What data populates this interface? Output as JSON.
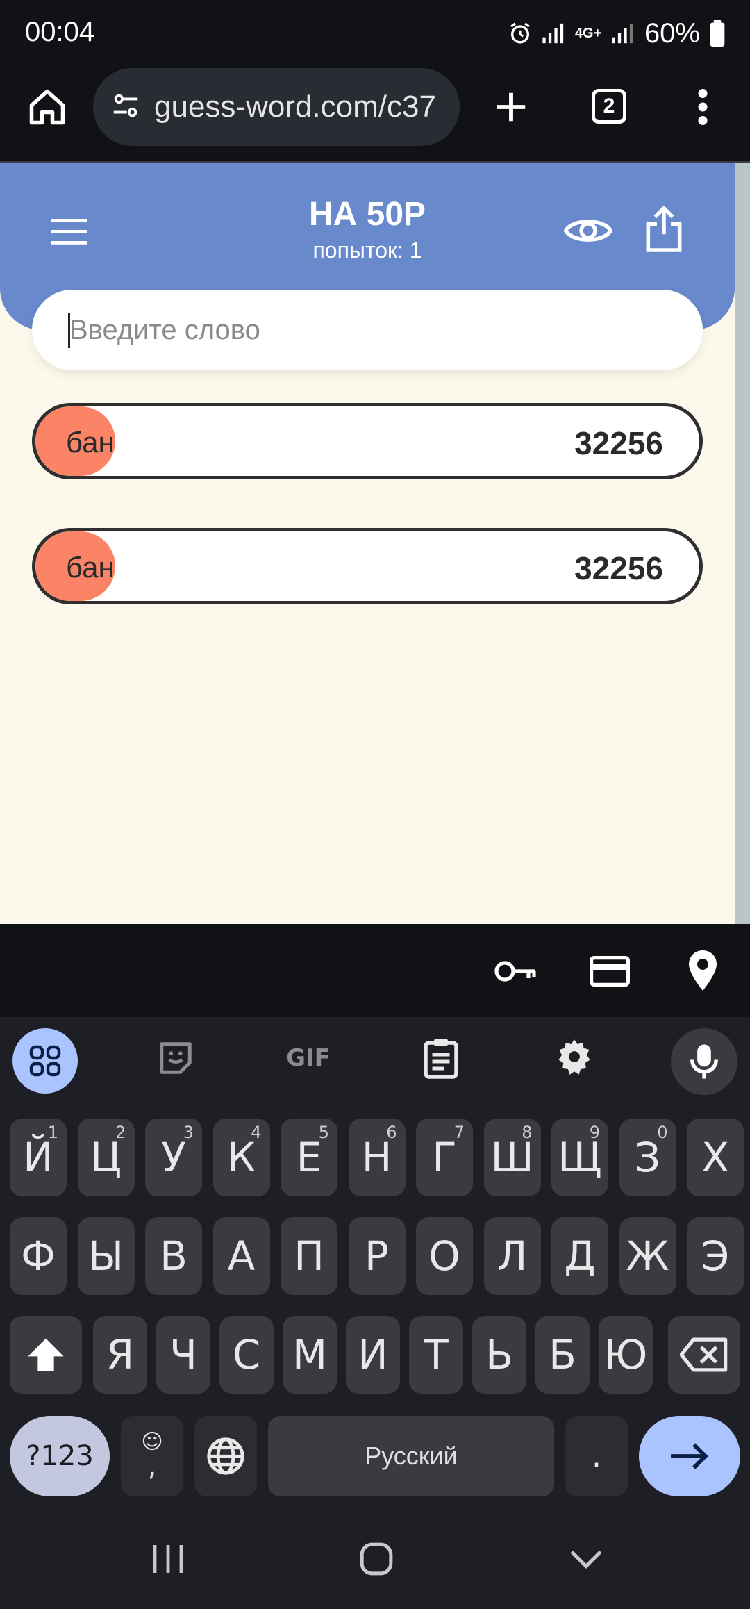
{
  "status": {
    "time": "00:04",
    "network": "4G+",
    "battery": "60%"
  },
  "browser": {
    "url": "guess-word.com/c37",
    "tabs_count": "2"
  },
  "page": {
    "title": "НА 50Р",
    "subtitle": "попыток: 1",
    "input_placeholder": "Введите слово",
    "guesses": [
      {
        "word": "бан",
        "score": "32256",
        "fill_fraction": 0.12
      },
      {
        "word": "бан",
        "score": "32256",
        "fill_fraction": 0.12
      }
    ],
    "colors": {
      "header": "#6889cc",
      "background": "#fdf8ec",
      "guess_fill": "#fb8466"
    }
  },
  "keyboard": {
    "row1": [
      {
        "k": "Й",
        "h": "1"
      },
      {
        "k": "Ц",
        "h": "2"
      },
      {
        "k": "У",
        "h": "3"
      },
      {
        "k": "К",
        "h": "4"
      },
      {
        "k": "Е",
        "h": "5"
      },
      {
        "k": "Н",
        "h": "6"
      },
      {
        "k": "Г",
        "h": "7"
      },
      {
        "k": "Ш",
        "h": "8"
      },
      {
        "k": "Щ",
        "h": "9"
      },
      {
        "k": "З",
        "h": "0"
      },
      {
        "k": "Х",
        "h": ""
      }
    ],
    "row2": [
      "Ф",
      "Ы",
      "В",
      "А",
      "П",
      "Р",
      "О",
      "Л",
      "Д",
      "Ж",
      "Э"
    ],
    "row3": [
      "Я",
      "Ч",
      "С",
      "М",
      "И",
      "Т",
      "Ь",
      "Б",
      "Ю"
    ],
    "symbols_label": "?123",
    "comma_label": ",",
    "space_label": "Русский",
    "period_label": ".",
    "toolbar_label_gif": "GIF"
  }
}
